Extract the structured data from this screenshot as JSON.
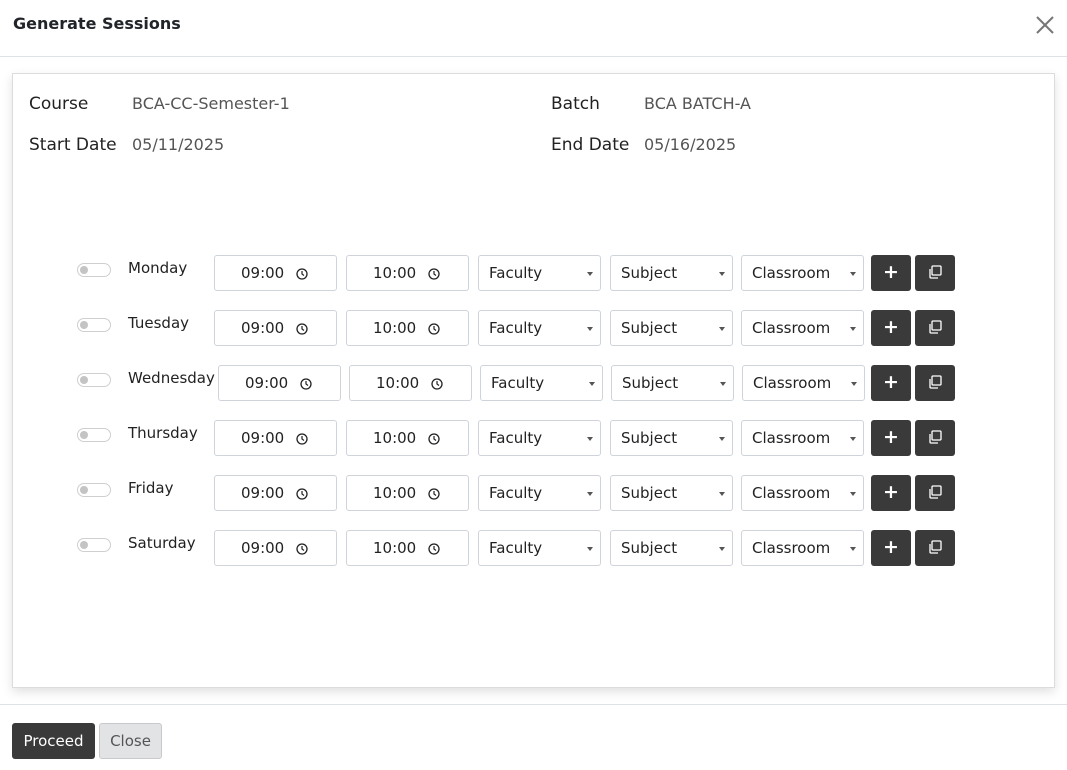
{
  "dialog": {
    "title": "Generate Sessions"
  },
  "info": {
    "course_label": "Course",
    "course_value": "BCA-CC-Semester-1",
    "batch_label": "Batch",
    "batch_value": "BCA BATCH-A",
    "start_label": "Start Date",
    "start_value": "05/11/2025",
    "end_label": "End Date",
    "end_value": "05/16/2025"
  },
  "rows": [
    {
      "day": "Monday",
      "start": "09:00",
      "end": "10:00",
      "faculty": "Faculty",
      "subject": "Subject",
      "classroom": "Classroom"
    },
    {
      "day": "Tuesday",
      "start": "09:00",
      "end": "10:00",
      "faculty": "Faculty",
      "subject": "Subject",
      "classroom": "Classroom"
    },
    {
      "day": "Wednesday",
      "start": "09:00",
      "end": "10:00",
      "faculty": "Faculty",
      "subject": "Subject",
      "classroom": "Classroom"
    },
    {
      "day": "Thursday",
      "start": "09:00",
      "end": "10:00",
      "faculty": "Faculty",
      "subject": "Subject",
      "classroom": "Classroom"
    },
    {
      "day": "Friday",
      "start": "09:00",
      "end": "10:00",
      "faculty": "Faculty",
      "subject": "Subject",
      "classroom": "Classroom"
    },
    {
      "day": "Saturday",
      "start": "09:00",
      "end": "10:00",
      "faculty": "Faculty",
      "subject": "Subject",
      "classroom": "Classroom"
    }
  ],
  "buttons": {
    "add_symbol": "+",
    "proceed": "Proceed",
    "close": "Close"
  },
  "icons": {
    "close": "close-icon",
    "clock": "clock-icon",
    "copy": "copy-icon",
    "caret": "caret-down-icon"
  },
  "colors": {
    "dark_button": "#3a3a3a",
    "close_button": "#e2e3e5",
    "border": "#ced4da"
  }
}
